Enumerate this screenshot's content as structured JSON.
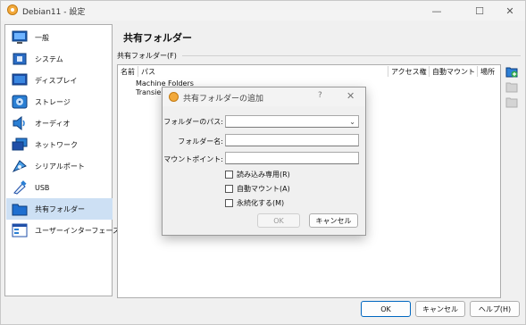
{
  "window": {
    "title": "Debian11 - 設定",
    "minimize": "—",
    "maximize": "☐",
    "close": "✕"
  },
  "sidebar": {
    "items": [
      {
        "label": "一般",
        "icon": "monitor-icon"
      },
      {
        "label": "システム",
        "icon": "chip-icon"
      },
      {
        "label": "ディスプレイ",
        "icon": "display-icon"
      },
      {
        "label": "ストレージ",
        "icon": "storage-icon"
      },
      {
        "label": "オーディオ",
        "icon": "speaker-icon"
      },
      {
        "label": "ネットワーク",
        "icon": "network-icon"
      },
      {
        "label": "シリアルポート",
        "icon": "serial-port-icon"
      },
      {
        "label": "USB",
        "icon": "usb-icon"
      },
      {
        "label": "共有フォルダー",
        "icon": "shared-folder-icon",
        "selected": true
      },
      {
        "label": "ユーザーインターフェース",
        "icon": "user-interface-icon"
      }
    ]
  },
  "main": {
    "section_title": "共有フォルダー",
    "group_label": "共有フォルダー(F)",
    "columns": [
      "名前",
      "パス",
      "アクセス権",
      "自動マウント",
      "場所"
    ],
    "tree": [
      {
        "label": "Machine Folders"
      },
      {
        "label": "Transient Folders"
      }
    ]
  },
  "buttons": {
    "ok": "OK",
    "cancel": "キャンセル",
    "help": "ヘルプ(H)"
  },
  "dialog": {
    "title": "共有フォルダーの追加",
    "help": "?",
    "close": "✕",
    "path_label": "フォルダーのパス:",
    "path_value": "",
    "name_label": "フォルダー名:",
    "name_value": "",
    "mount_label": "マウントポイント:",
    "mount_value": "",
    "readonly_label": "読み込み専用(R)",
    "automount_label": "自動マウント(A)",
    "permanent_label": "永続化する(M)",
    "ok": "OK",
    "cancel": "キャンセル"
  },
  "colors": {
    "accent": "#0067c0",
    "selection": "#cde0f4",
    "vbox_orange": "#f2a93b"
  }
}
